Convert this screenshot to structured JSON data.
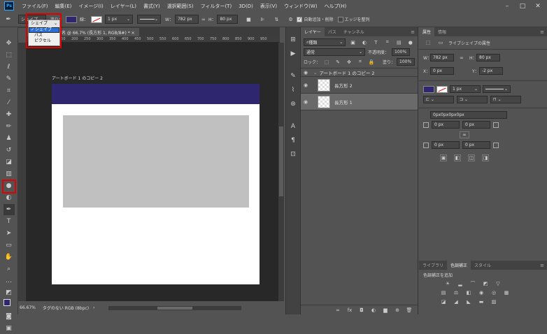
{
  "app": {
    "logo": "Ps"
  },
  "menu": [
    "ファイル(F)",
    "編集(E)",
    "イメージ(I)",
    "レイヤー(L)",
    "書式(Y)",
    "選択範囲(S)",
    "フィルター(T)",
    "3D(D)",
    "表示(V)",
    "ウィンドウ(W)",
    "ヘルプ(H)"
  ],
  "options_bar": {
    "mode_value": "シェイプ",
    "mode_options": [
      "シェイプ",
      "パス",
      "ピクセル"
    ],
    "fill_label": "塗り：",
    "stroke_label": "線：",
    "stroke_width": "1 px",
    "w_label": "W：",
    "w_value": "782 px",
    "h_label": "H：",
    "h_value": "80 px",
    "auto_add_delete": "自動追加・削除",
    "align_edges": "エッジを整列",
    "fill_color": "#2e2770"
  },
  "document": {
    "tab_title": "名 @ 66.7% (長方形 1, RGB/8#) *",
    "tab_close": "×",
    "artboard_label": "アートボード 1 のコピー 2",
    "ruler_marks": [
      "50",
      "100",
      "150",
      "200",
      "250",
      "300",
      "350",
      "400",
      "450",
      "500",
      "550",
      "600",
      "650",
      "700",
      "750",
      "800",
      "850",
      "900",
      "950"
    ]
  },
  "status": {
    "zoom": "66.67%",
    "profile": "タグのない RGB (8bpc)",
    "arrow": "›"
  },
  "layers_panel": {
    "tabs": [
      "レイヤー",
      "パス",
      "チャンネル"
    ],
    "filter_label": "種類",
    "blend_mode": "通常",
    "opacity_label": "不透明度：",
    "opacity_value": "100%",
    "lock_label": "ロック：",
    "fill_label": "塗り：",
    "fill_value": "100%",
    "layers": [
      {
        "name": "アートボード 1 のコピー 2",
        "type": "artboard"
      },
      {
        "name": "長方形 2",
        "type": "shape"
      },
      {
        "name": "長方形 1",
        "type": "shape",
        "selected": true
      }
    ]
  },
  "properties_panel": {
    "tabs": [
      "属性",
      "情報"
    ],
    "title": "ライブシェイプの属性",
    "w_label": "W：",
    "w_value": "782 px",
    "h_label": "H：",
    "h_value": "80 px",
    "x_label": "X：",
    "x_value": "0 px",
    "y_label": "Y：",
    "y_value": "-2 px",
    "stroke_width": "1 px",
    "corner_summary": "0px0px0px0px",
    "corners": [
      "0 px",
      "0 px",
      "0 px",
      "0 px"
    ]
  },
  "adjust_panel": {
    "tabs": [
      "ライブラリ",
      "色調補正",
      "スタイル"
    ],
    "title": "色調補正を追加"
  },
  "colors": {
    "artboard_header": "#2e2770",
    "rect_gray": "#c0c0c0",
    "highlight": "#e00000"
  }
}
